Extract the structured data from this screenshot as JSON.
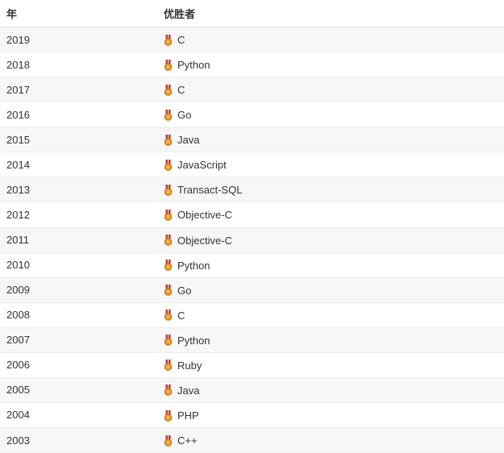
{
  "headers": {
    "year": "年",
    "winner": "优胜者"
  },
  "rows": [
    {
      "year": "2019",
      "winner": "C"
    },
    {
      "year": "2018",
      "winner": "Python"
    },
    {
      "year": "2017",
      "winner": "C"
    },
    {
      "year": "2016",
      "winner": "Go"
    },
    {
      "year": "2015",
      "winner": "Java"
    },
    {
      "year": "2014",
      "winner": "JavaScript"
    },
    {
      "year": "2013",
      "winner": "Transact-SQL"
    },
    {
      "year": "2012",
      "winner": "Objective-C"
    },
    {
      "year": "2011",
      "winner": "Objective-C"
    },
    {
      "year": "2010",
      "winner": "Python"
    },
    {
      "year": "2009",
      "winner": "Go"
    },
    {
      "year": "2008",
      "winner": "C"
    },
    {
      "year": "2007",
      "winner": "Python"
    },
    {
      "year": "2006",
      "winner": "Ruby"
    },
    {
      "year": "2005",
      "winner": "Java"
    },
    {
      "year": "2004",
      "winner": "PHP"
    },
    {
      "year": "2003",
      "winner": "C++"
    }
  ]
}
